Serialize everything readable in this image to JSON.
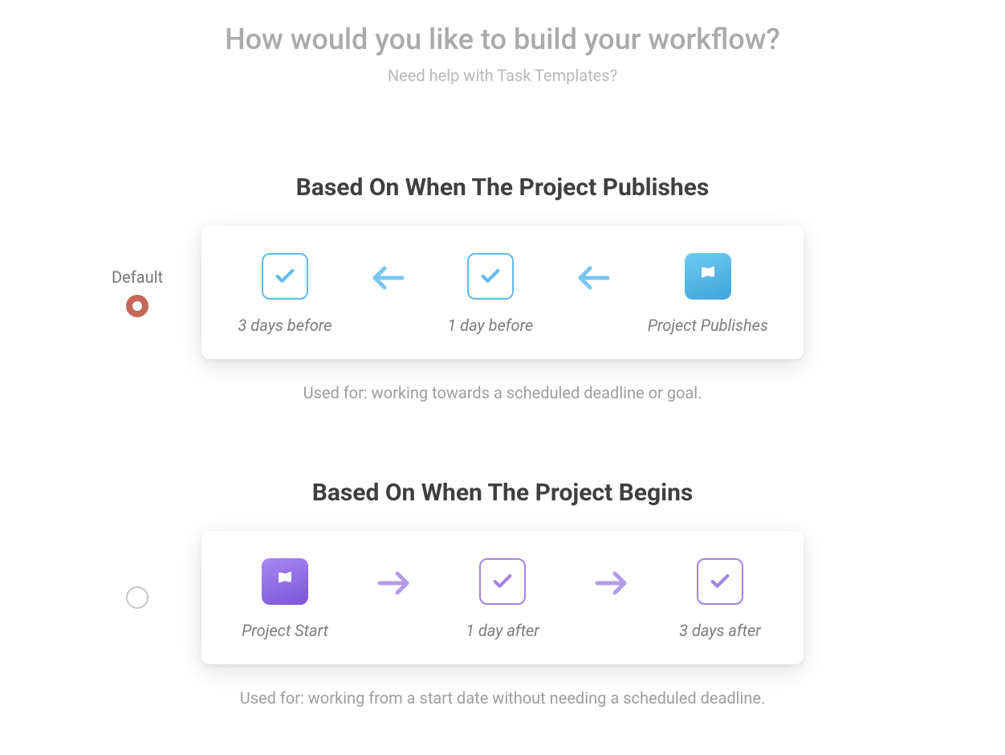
{
  "header": {
    "title": "How would you like to build your workflow?",
    "subtitle": "Need help with Task Templates?"
  },
  "options": [
    {
      "radio_label": "Default",
      "selected": true,
      "title": "Based On When The Project Publishes",
      "caption": "Used for: working towards a scheduled deadline or goal.",
      "cells": {
        "c1": "3 days before",
        "c2": "1 day before",
        "c3": "Project Publishes"
      }
    },
    {
      "radio_label": "",
      "selected": false,
      "title": "Based On When The Project Begins",
      "caption": "Used for: working from a start date without needing a scheduled deadline.",
      "cells": {
        "c1": "Project Start",
        "c2": "1 day after",
        "c3": "3 days after"
      }
    }
  ],
  "colors": {
    "blue": "#62b9e9",
    "purple": "#a384e3",
    "radio_accent": "#c4675a"
  }
}
